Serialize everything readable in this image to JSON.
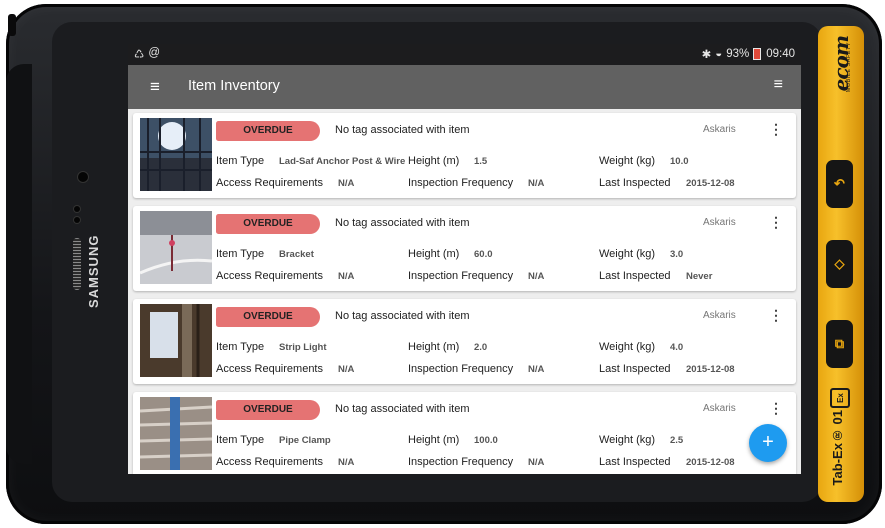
{
  "status_bar": {
    "left_icons": [
      "♺",
      "@"
    ],
    "signal": "✱",
    "wifi": "◒",
    "battery": "93%",
    "time": "09:40"
  },
  "app_bar": {
    "title": "Item Inventory",
    "menu_icon": "≡",
    "filter_icon": "≡"
  },
  "device": {
    "brand": "SAMSUNG",
    "side_logo": "ecom",
    "side_tagline": "MOBILE SAFETY",
    "model": "Tab-Ex® 01",
    "ex_mark": "Ex"
  },
  "labels": {
    "item_type": "Item Type",
    "height": "Height (m)",
    "weight": "Weight (kg)",
    "access": "Access Requirements",
    "frequency": "Inspection Frequency",
    "last_inspected": "Last Inspected"
  },
  "items": [
    {
      "status": "OVERDUE",
      "tag": "No tag associated with item",
      "owner": "Askaris",
      "item_type": "Lad-Saf Anchor Post & Wire",
      "height": "1.5",
      "weight": "10.0",
      "access": "N/A",
      "frequency": "N/A",
      "last_inspected": "2015-12-08"
    },
    {
      "status": "OVERDUE",
      "tag": "No tag associated with item",
      "owner": "Askaris",
      "item_type": "Bracket",
      "height": "60.0",
      "weight": "3.0",
      "access": "N/A",
      "frequency": "N/A",
      "last_inspected": "Never"
    },
    {
      "status": "OVERDUE",
      "tag": "No tag associated with item",
      "owner": "Askaris",
      "item_type": "Strip Light",
      "height": "2.0",
      "weight": "4.0",
      "access": "N/A",
      "frequency": "N/A",
      "last_inspected": "2015-12-08"
    },
    {
      "status": "OVERDUE",
      "tag": "No tag associated with item",
      "owner": "Askaris",
      "item_type": "Pipe Clamp",
      "height": "100.0",
      "weight": "2.5",
      "access": "N/A",
      "frequency": "N/A",
      "last_inspected": "2015-12-08"
    }
  ],
  "fab_label": "+",
  "colors": {
    "overdue": "#e57373",
    "fab": "#1e9bf0",
    "appbar": "#616161",
    "device_accent": "#f2b21c"
  }
}
